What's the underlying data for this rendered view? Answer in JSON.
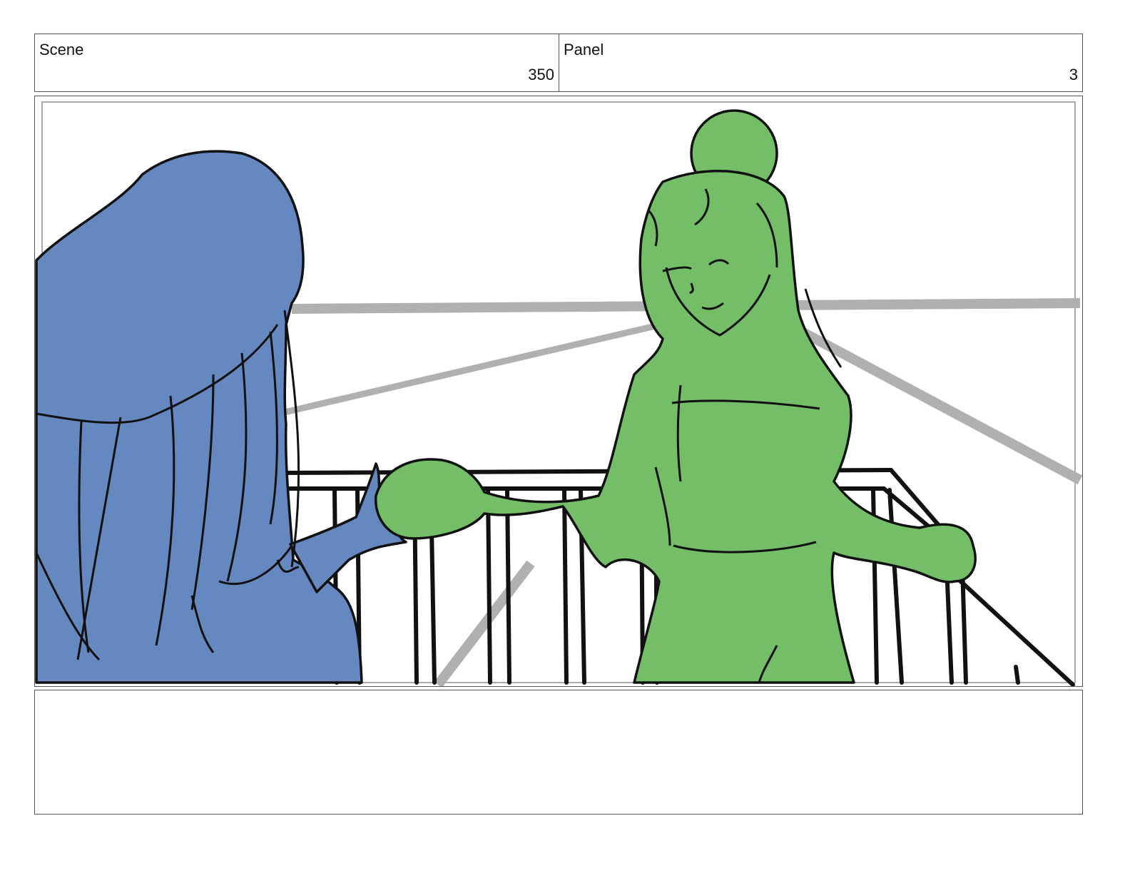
{
  "header": {
    "scene_label": "Scene",
    "scene_value": "350",
    "panel_label": "Panel",
    "panel_value": "3"
  },
  "artwork": {
    "description_name": "storyboard-illustration",
    "colors": {
      "left_character_fill": "#6688c0",
      "right_character_fill": "#73be66",
      "railing_stroke": "#111111",
      "background_line": "#b0b0b0",
      "frame_border": "#aaaaaa"
    }
  },
  "notes": {
    "text": ""
  }
}
